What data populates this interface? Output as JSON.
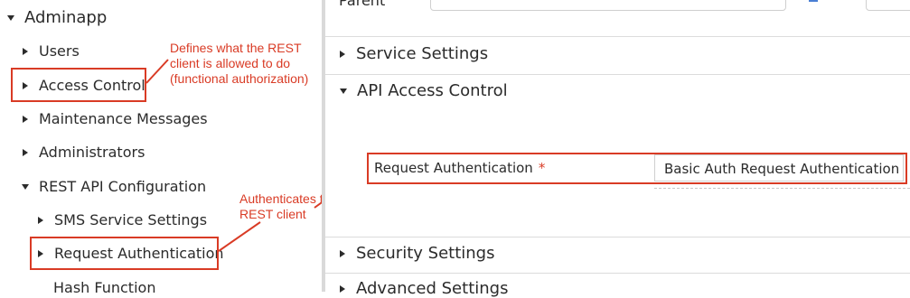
{
  "tree": {
    "root": "Adminapp",
    "items": [
      {
        "label": "Users"
      },
      {
        "label": "Access Control"
      },
      {
        "label": "Maintenance Messages"
      },
      {
        "label": "Administrators"
      },
      {
        "label": "REST API Configuration"
      },
      {
        "label": "SMS Service Settings"
      },
      {
        "label": "Request Authentication"
      },
      {
        "label": "Hash Function"
      }
    ]
  },
  "annotations": {
    "access_control": [
      "Defines what the REST",
      "client is allowed to do",
      "(functional authorization)"
    ],
    "request_auth": [
      "Authenticates the",
      "REST client"
    ],
    "color": "#d93b25"
  },
  "top": {
    "parent_label": "Parent"
  },
  "sections": {
    "service": "Service Settings",
    "api_access": "API Access Control",
    "security": "Security Settings",
    "advanced": "Advanced Settings"
  },
  "form": {
    "request_auth_label": "Request Authentication",
    "required_marker": "*",
    "request_auth_value": "Basic Auth Request Authentication"
  }
}
